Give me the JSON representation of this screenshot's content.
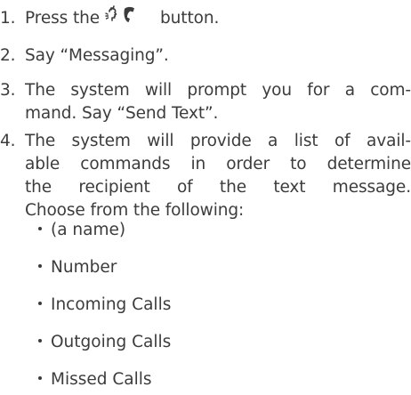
{
  "steps": [
    {
      "number": "1.",
      "before_icon": "Press the",
      "icon": "voice-command-phone-icon",
      "after_icon": "button."
    },
    {
      "number": "2.",
      "text": "Say “Messaging”."
    },
    {
      "number": "3.",
      "lines": [
        "The system will prompt you for a com-",
        "mand. Say “Send Text”."
      ]
    },
    {
      "number": "4.",
      "lines": [
        "The system will provide a list of avail-",
        "able commands in order to determine",
        "the recipient of the text message.",
        "Choose from the following:"
      ]
    }
  ],
  "options": [
    "(a name)",
    "Number",
    "Incoming Calls",
    "Outgoing Calls",
    "Missed Calls"
  ],
  "colors": {
    "text": "#3c3c3c"
  }
}
